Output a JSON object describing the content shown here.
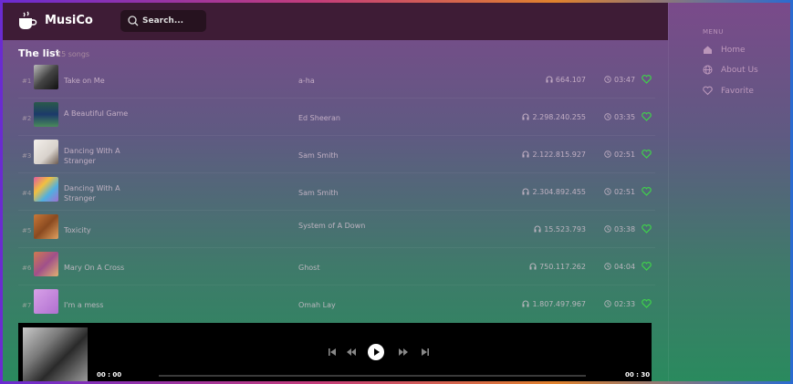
{
  "app": {
    "name": "MusiCo"
  },
  "search": {
    "placeholder": "Search..."
  },
  "list": {
    "title": "The list",
    "count": "25 songs"
  },
  "songs": [
    {
      "num": "#1",
      "title": "Take on Me",
      "artist": "a-ha",
      "plays": "664.107",
      "duration": "03:47"
    },
    {
      "num": "#2",
      "title": "A Beautiful Game",
      "artist": "Ed Sheeran",
      "plays": "2.298.240.255",
      "duration": "03:35"
    },
    {
      "num": "#3",
      "title": "Dancing With A Stranger",
      "artist": "Sam Smith",
      "plays": "2.122.815.927",
      "duration": "02:51"
    },
    {
      "num": "#4",
      "title": "Dancing With A Stranger",
      "artist": "Sam Smith",
      "plays": "2.304.892.455",
      "duration": "02:51"
    },
    {
      "num": "#5",
      "title": "Toxicity",
      "artist": "System of A Down",
      "plays": "15.523.793",
      "duration": "03:38"
    },
    {
      "num": "#6",
      "title": "Mary On A Cross",
      "artist": "Ghost",
      "plays": "750.117.262",
      "duration": "04:04"
    },
    {
      "num": "#7",
      "title": "I'm a mess",
      "artist": "Omah Lay",
      "plays": "1.807.497.967",
      "duration": "02:33"
    }
  ],
  "player": {
    "current_time": "00 : 00",
    "total_time": "00 : 30",
    "progress": 0
  },
  "sidebar": {
    "menu_label": "MENU",
    "items": [
      {
        "label": "Home",
        "icon": "home-icon"
      },
      {
        "label": "About Us",
        "icon": "globe-icon"
      },
      {
        "label": "Favorite",
        "icon": "heart-icon"
      }
    ]
  },
  "colors": {
    "accent_green": "#3fd14a",
    "topbar": "#3e1c36",
    "player_bg": "#000000"
  }
}
